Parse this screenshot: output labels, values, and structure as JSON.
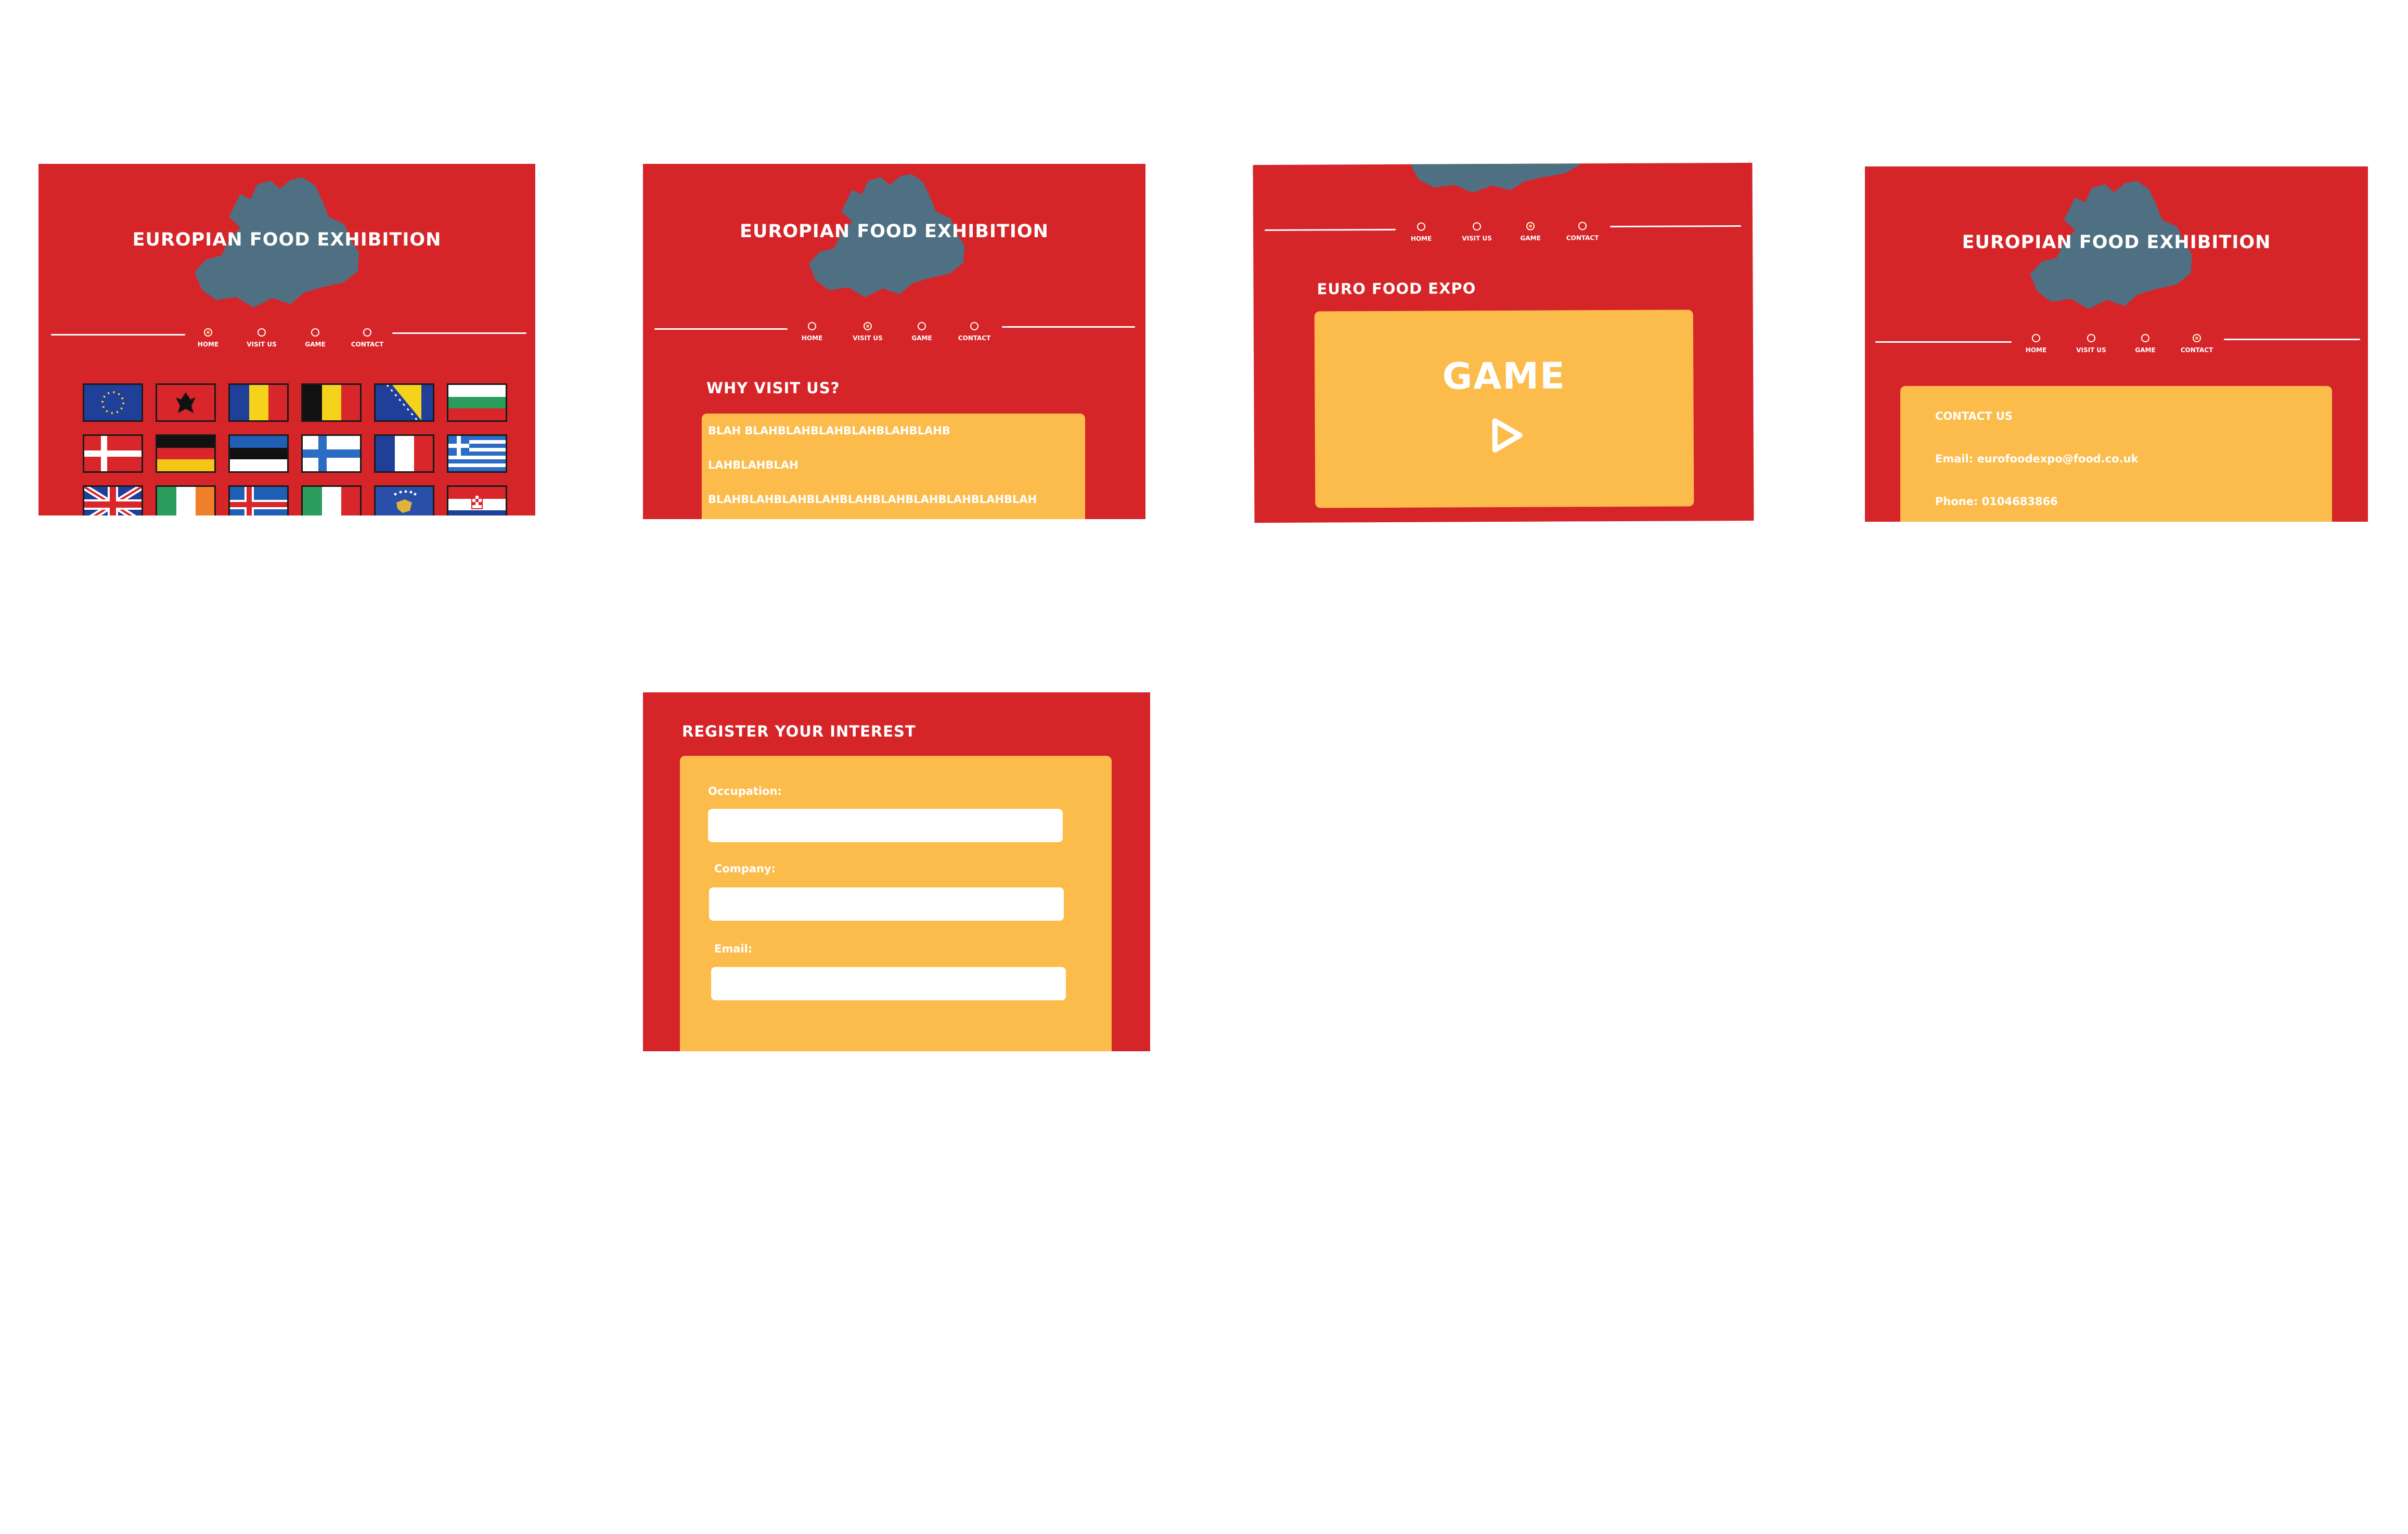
{
  "colors": {
    "background": "#ffffff",
    "frame_red": "#d62529",
    "panel_yellow": "#fcbc4c",
    "map_blue": "#4f7082",
    "text": "#ffffff"
  },
  "site": {
    "title": "EUROPIAN FOOD EXHIBITION"
  },
  "nav": {
    "home": "HOME",
    "visit": "VISIT US",
    "game": "GAME",
    "contact": "CONTACT"
  },
  "home_screen": {
    "selected_nav": "HOME",
    "flags": [
      {
        "name": "european-union"
      },
      {
        "name": "albania"
      },
      {
        "name": "romania"
      },
      {
        "name": "belgium"
      },
      {
        "name": "bosnia-and-herzegovina"
      },
      {
        "name": "bulgaria"
      },
      {
        "name": "denmark"
      },
      {
        "name": "germany"
      },
      {
        "name": "estonia"
      },
      {
        "name": "finland"
      },
      {
        "name": "france"
      },
      {
        "name": "greece"
      },
      {
        "name": "united-kingdom"
      },
      {
        "name": "ireland"
      },
      {
        "name": "iceland"
      },
      {
        "name": "italy"
      },
      {
        "name": "kosovo"
      },
      {
        "name": "croatia"
      }
    ]
  },
  "visit_screen": {
    "selected_nav": "VISIT US",
    "heading": "WHY VISIT US?",
    "lines": [
      "BLAH BLAHBLAHBLAHBLAHBLAHBLAHB",
      "LAHBLAHBLAH",
      "BLAHBLAHBLAHBLAHBLAHBLAHBLAHBLAHBLAHBLAH"
    ]
  },
  "game_screen": {
    "selected_nav": "GAME",
    "heading": "EURO FOOD EXPO",
    "game_label": "GAME",
    "play_icon": "play-icon"
  },
  "contact_screen": {
    "selected_nav": "CONTACT",
    "heading": "CONTACT US",
    "email_line": "Email: eurofoodexpo@food.co.uk",
    "phone_line": "Phone: 0104683866"
  },
  "register_screen": {
    "heading": "REGISTER YOUR INTEREST",
    "fields": [
      {
        "label": "Occupation:",
        "value": ""
      },
      {
        "label": "Company:",
        "value": ""
      },
      {
        "label": "Email:",
        "value": ""
      }
    ]
  }
}
